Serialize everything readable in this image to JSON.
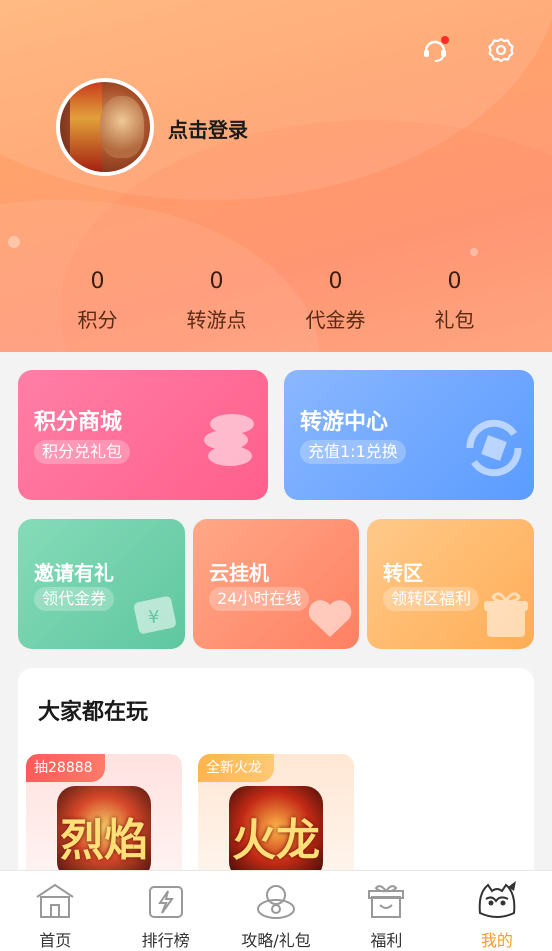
{
  "header": {
    "login_text": "点击登录",
    "service_icon": "headset-service-icon",
    "settings_icon": "gear-icon",
    "stats": [
      {
        "value": "0",
        "label": "积分"
      },
      {
        "value": "0",
        "label": "转游点"
      },
      {
        "value": "0",
        "label": "代金券"
      },
      {
        "value": "0",
        "label": "礼包"
      }
    ]
  },
  "cards": {
    "points_mall": {
      "title": "积分商城",
      "tag": "积分兑礼包"
    },
    "transfer_center": {
      "title": "转游中心",
      "tag": "充值1:1兑换"
    },
    "invite": {
      "title": "邀请有礼",
      "tag": "领代金券"
    },
    "cloud": {
      "title": "云挂机",
      "tag": "24小时在线"
    },
    "zone": {
      "title": "转区",
      "tag": "领转区福利"
    }
  },
  "playing": {
    "title": "大家都在玩",
    "games": [
      {
        "badge": "抽28888",
        "icon_text": "烈焰"
      },
      {
        "badge": "全新火龙",
        "icon_text": "火龙"
      }
    ]
  },
  "tabs": [
    {
      "label": "首页",
      "icon": "home-icon"
    },
    {
      "label": "排行榜",
      "icon": "ranking-icon"
    },
    {
      "label": "攻略/礼包",
      "icon": "gift-guide-icon"
    },
    {
      "label": "福利",
      "icon": "gift-box-icon"
    },
    {
      "label": "我的",
      "icon": "profile-mascot-icon"
    }
  ],
  "colors": {
    "active_tab": "#ff9a2a",
    "points_card": "#ff6f98",
    "transfer_card": "#6fa8ff",
    "invite_card": "#71d1ac",
    "cloud_card": "#ff9274",
    "zone_card": "#ffbc6e"
  }
}
